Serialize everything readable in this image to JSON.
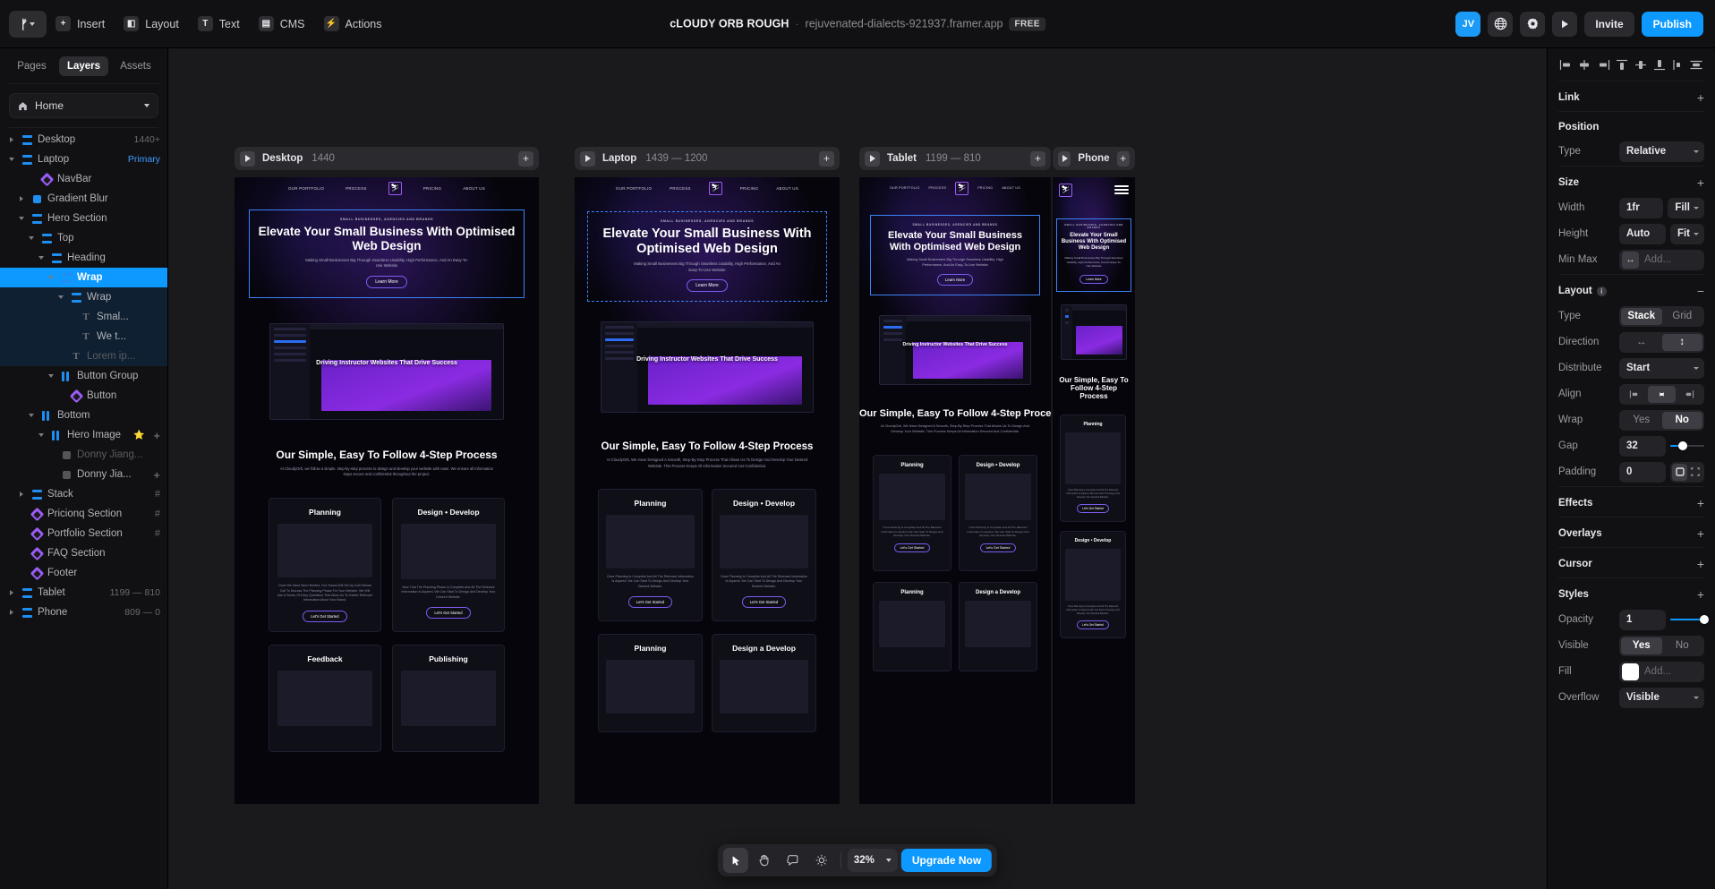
{
  "topbar": {
    "logo_label": "framer-logo",
    "menus": [
      {
        "label": "Insert",
        "icon": "plus-square-icon",
        "glyph": "+"
      },
      {
        "label": "Layout",
        "icon": "layout-icon",
        "glyph": "◧"
      },
      {
        "label": "Text",
        "icon": "text-icon",
        "glyph": "T"
      },
      {
        "label": "CMS",
        "icon": "database-icon",
        "glyph": "▤"
      },
      {
        "label": "Actions",
        "icon": "bolt-icon",
        "glyph": "⚡"
      }
    ],
    "project_name": "cLOUDY ORB ROUGH",
    "separator": "·",
    "project_url": "rejuvenated-dialects-921937.framer.app",
    "plan_badge": "FREE",
    "avatar_initials": "JV",
    "globe_icon": "globe-icon",
    "settings_icon": "gear-icon",
    "preview_icon": "play-icon",
    "invite_label": "Invite",
    "publish_label": "Publish",
    "publish_color": "#0d99ff"
  },
  "left_panel": {
    "tabs": [
      {
        "label": "Pages",
        "active": false
      },
      {
        "label": "Layers",
        "active": true
      },
      {
        "label": "Assets",
        "active": false
      }
    ],
    "page": {
      "label": "Home",
      "icon": "home-icon"
    },
    "layers": [
      {
        "name": "Desktop",
        "depth": 0,
        "icon": "stack",
        "disclosure": "closed",
        "meta": "1440+"
      },
      {
        "name": "Laptop",
        "depth": 0,
        "icon": "stack",
        "disclosure": "open",
        "meta": "Primary",
        "meta_primary": true
      },
      {
        "name": "NavBar",
        "depth": 2,
        "icon": "comp"
      },
      {
        "name": "Gradient Blur",
        "depth": 1,
        "icon": "square",
        "disclosure": "closed"
      },
      {
        "name": "Hero Section",
        "depth": 1,
        "icon": "stack",
        "disclosure": "open"
      },
      {
        "name": "Top",
        "depth": 2,
        "icon": "stack",
        "disclosure": "open"
      },
      {
        "name": "Heading",
        "depth": 3,
        "icon": "stack",
        "disclosure": "open"
      },
      {
        "name": "Wrap",
        "depth": 4,
        "icon": "stack",
        "disclosure": "open",
        "selected": true
      },
      {
        "name": "Wrap",
        "depth": 5,
        "icon": "stack",
        "disclosure": "open",
        "inpath": true
      },
      {
        "name": "Smal...",
        "depth": 6,
        "icon": "text",
        "inpath": true
      },
      {
        "name": "We t...",
        "depth": 6,
        "icon": "text",
        "inpath": true
      },
      {
        "name": "Lorem ip...",
        "depth": 5,
        "icon": "text",
        "inpath": true,
        "dim": true
      },
      {
        "name": "Button Group",
        "depth": 4,
        "icon": "cols",
        "disclosure": "open"
      },
      {
        "name": "Button",
        "depth": 5,
        "icon": "comp"
      },
      {
        "name": "Bottom",
        "depth": 2,
        "icon": "cols",
        "disclosure": "open"
      },
      {
        "name": "Hero Image",
        "depth": 3,
        "icon": "cols",
        "disclosure": "open",
        "star": "⭐",
        "plus": "+"
      },
      {
        "name": "Donny Jiang...",
        "depth": 4,
        "icon": "square-gray",
        "dim": true
      },
      {
        "name": "Donny Jia...",
        "depth": 4,
        "icon": "square-gray",
        "plus": "+"
      },
      {
        "name": "Stack",
        "depth": 1,
        "icon": "stack",
        "disclosure": "closed",
        "hash": "#"
      },
      {
        "name": "Pricionq Section",
        "depth": 1,
        "icon": "comp",
        "hash": "#"
      },
      {
        "name": "Portfolio Section",
        "depth": 1,
        "icon": "comp",
        "hash": "#"
      },
      {
        "name": "FAQ Section",
        "depth": 1,
        "icon": "comp"
      },
      {
        "name": "Footer",
        "depth": 1,
        "icon": "comp"
      },
      {
        "name": "Tablet",
        "depth": 0,
        "icon": "stack",
        "disclosure": "closed",
        "meta": "1199 — 810"
      },
      {
        "name": "Phone",
        "depth": 0,
        "icon": "stack",
        "disclosure": "closed",
        "meta": "809 — 0"
      }
    ]
  },
  "canvas": {
    "frames": [
      {
        "id": "desktop",
        "name": "Desktop",
        "size": "1440"
      },
      {
        "id": "laptop",
        "name": "Laptop",
        "size": "1439 — 1200"
      },
      {
        "id": "tablet",
        "name": "Tablet",
        "size": "1199 — 810"
      },
      {
        "id": "phone",
        "name": "Phone",
        "size": ""
      }
    ],
    "site": {
      "nav_links": [
        "OUR PORTFOLIO",
        "PROCESS",
        "PRICING",
        "ABOUT US"
      ],
      "hero_eyebrow": "SMALL BUSINESSES, AGENCIES AND BRANDS",
      "hero_title": "Elevate Your Small Business With Optimised Web Design",
      "hero_sub": "Making Small Businesses Big Through Seamless Usability, High Performance, And An Easy-To-Use Website",
      "hero_cta": "Learn More",
      "shot_caption": "Driving Instructor Websites That Drive Success",
      "process_title": "Our Simple, Easy To Follow 4-Step Process",
      "process_sub_desktop": "At CloudyOrb, we follow a simple, step-by-step process to design and develop your website with ease. We ensure all information stays secure and confidential throughout the project.",
      "process_sub_laptop": "At CloudyOrb, We Have Designed A Smooth, Step-By-Step Process That Allows Us To Design And Develop Your Desired Website. This Process Keeps All Information Secured And Confidential.",
      "process_sub_tablet": "At CloudyOrb, We Have Designed A Smooth, Step-By-Step Process That Allows Us To Design And Develop Your Website. This Process Keeps All Information Secured And Confidential.",
      "cards": [
        {
          "title": "Planning",
          "body": "Once We Have Been Briefed, Our Teams Will Set Up A 60 Minute Call To Discuss The Planning Phase For Your Website. We Will Ask A Series Of Easy Questions That Allow Us To Gather Relevant Information About Your Brand.",
          "cta": "Let's Get Started"
        },
        {
          "title": "Design • Develop",
          "body": "Now That The Planning Phase Is Complete And All The Relevant Information Is Aquired, We Can Start To Design And Develop Your Desired Website.",
          "cta": "Let's Get Started"
        },
        {
          "title": "Planning",
          "body": "Once Planning Is Complete And All The Relevant Information Is Aquired, We Can Start To Design And Develop Your Desired Website.",
          "cta": "Let's Get Started"
        },
        {
          "title": "Design a Develop",
          "body": "Once Planning Is Complete And All The Relevant Information Is Aquired, We Can Start To Design And Develop Your Desired Website.",
          "cta": "Let's Get Started"
        }
      ],
      "cards_extra": [
        {
          "title": "Feedback"
        },
        {
          "title": "Publishing"
        }
      ],
      "phone_title": "Our Simple, Easy To Follow 4-Step Process"
    }
  },
  "bottom_toolbar": {
    "tools": [
      {
        "name": "cursor-tool",
        "glyph": "➤",
        "active": true
      },
      {
        "name": "hand-tool",
        "glyph": "✋",
        "active": false
      },
      {
        "name": "comment-tool",
        "glyph": "💬",
        "active": false
      },
      {
        "name": "theme-tool",
        "glyph": "☀",
        "active": false
      }
    ],
    "zoom_value": "32%",
    "upgrade_label": "Upgrade Now"
  },
  "right_panel": {
    "align_icons": [
      "align-left-icon",
      "align-center-horizontal-icon",
      "align-right-icon",
      "align-top-icon",
      "align-center-vertical-icon",
      "align-bottom-icon",
      "distribute-vertical-icon",
      "distribute-horizontal-icon"
    ],
    "sections": {
      "link": {
        "title": "Link",
        "action": "+"
      },
      "position": {
        "title": "Position",
        "action": "",
        "type_label": "Type",
        "type_value": "Relative"
      },
      "size": {
        "title": "Size",
        "action": "+",
        "width_label": "Width",
        "width_value": "1fr",
        "width_mode": "Fill",
        "height_label": "Height",
        "height_value": "Auto",
        "height_mode": "Fit",
        "minmax_label": "Min Max",
        "minmax_placeholder": "Add...",
        "minmax_icon": "↔"
      },
      "layout": {
        "title": "Layout",
        "action": "−",
        "info": "i",
        "type_label": "Type",
        "type_options": [
          "Stack",
          "Grid"
        ],
        "type_selected": "Stack",
        "direction_label": "Direction",
        "direction_options": [
          "↔",
          "↕"
        ],
        "direction_selected": "↕",
        "distribute_label": "Distribute",
        "distribute_value": "Start",
        "align_label": "Align",
        "align_selected": 1,
        "wrap_label": "Wrap",
        "wrap_options": [
          "Yes",
          "No"
        ],
        "wrap_selected": "No",
        "gap_label": "Gap",
        "gap_value": "32",
        "gap_pct": 38,
        "padding_label": "Padding",
        "padding_value": "0"
      },
      "effects": {
        "title": "Effects",
        "action": "+"
      },
      "overlays": {
        "title": "Overlays",
        "action": "+"
      },
      "cursor": {
        "title": "Cursor",
        "action": "+"
      },
      "styles": {
        "title": "Styles",
        "action": "+",
        "opacity_label": "Opacity",
        "opacity_value": "1",
        "opacity_pct": 100,
        "visible_label": "Visible",
        "visible_options": [
          "Yes",
          "No"
        ],
        "visible_selected": "Yes",
        "fill_label": "Fill",
        "fill_placeholder": "Add...",
        "fill_color": "#ffffff",
        "overflow_label": "Overflow",
        "overflow_value": "Visible"
      }
    }
  }
}
